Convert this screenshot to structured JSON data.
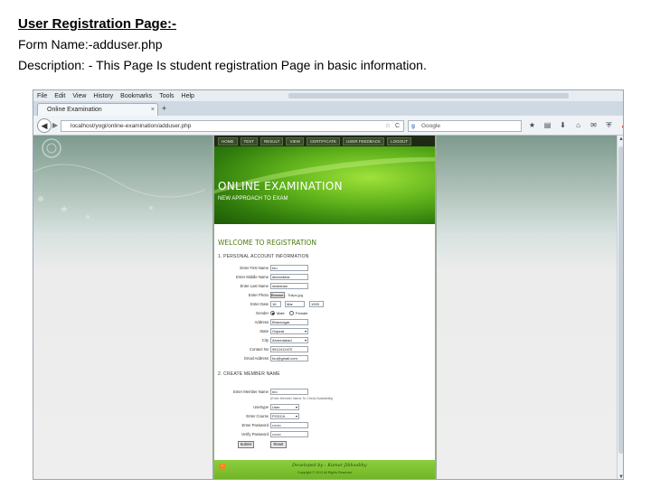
{
  "document": {
    "heading": "User Registration Page:-",
    "form_name": "Form Name:-adduser.php",
    "description": "Description: - This Page Is student registration Page in basic information."
  },
  "browser": {
    "menu": [
      "File",
      "Edit",
      "View",
      "History",
      "Bookmarks",
      "Tools",
      "Help"
    ],
    "tab_title": "Online Examination",
    "tab_close": "×",
    "new_tab": "+",
    "url": "localhost/yogi/online-examination/adduser.php",
    "search_placeholder": "Google",
    "search_logo": "g",
    "nav_back": "◀",
    "nav_forward": "▶",
    "reload": "C",
    "star": "☆",
    "toolbar_icons": [
      "star-icon",
      "bookmarks-icon",
      "download-icon",
      "home-icon",
      "share-icon",
      "shield-icon",
      "addon-icon",
      "help-icon",
      "menu-icon"
    ],
    "toolbar_glyphs": [
      "★",
      "▤",
      "⬇",
      "⌂",
      "✉",
      "⛨",
      "✗",
      "?",
      "≡"
    ]
  },
  "site": {
    "nav": [
      "HOME",
      "TEST",
      "RESULT",
      "VIEW",
      "CERTIFICATE",
      "USER FEEDBACK",
      "LOGOUT"
    ],
    "banner_title": "ONLINE EXAMINATION",
    "banner_subtitle": "NEW APPROACH TO EXAM",
    "welcome": "WELCOME TO REGISTRATION",
    "section1_title": "1. PERSONAL ACCOUNT INFORMATION",
    "section2_title": "2. CREATE MEMBER NAME",
    "personal_fields": [
      {
        "label": "Enter First Name",
        "value": "kru"
      },
      {
        "label": "Enter Middle Name",
        "value": "dineshbhai"
      },
      {
        "label": "Enter Last Name",
        "value": "shakshan"
      }
    ],
    "photo_label": "Enter Photo",
    "photo_button": "Browse...",
    "photo_file": "Tulips.jpg",
    "dob_label": "Enter Date",
    "dob_day": "16",
    "dob_month": "Mar",
    "dob_year": "1993",
    "gender_label": "Gender",
    "gender_male": "Male",
    "gender_female": "Female",
    "after_fields": [
      {
        "label": "Address",
        "value": "Bhavnagar",
        "type": "input"
      },
      {
        "label": "State",
        "value": "Gujarat",
        "type": "select"
      },
      {
        "label": "City",
        "value": "Ahmedabad",
        "type": "select"
      },
      {
        "label": "Contact No",
        "value": "9512412470",
        "type": "input"
      },
      {
        "label": "Email Address",
        "value": "kru@gmail.com",
        "type": "input"
      }
    ],
    "member_fields": [
      {
        "label": "Enter Member Name",
        "value": "kru",
        "type": "input"
      },
      {
        "label": "",
        "value": "(Enter Member Name To Check Availability)",
        "type": "hint"
      },
      {
        "label": "Usertype",
        "value": "User",
        "type": "select"
      },
      {
        "label": "Enter Course",
        "value": "PGDCA",
        "type": "select"
      },
      {
        "label": "Enter Password",
        "value": "•••••••",
        "type": "input"
      },
      {
        "label": "Verify Password",
        "value": "•••••••",
        "type": "input"
      }
    ],
    "submit_label": "Submit",
    "reset_label": "Reset",
    "footer_title": "Developed by : Kumar Jibhsabhy",
    "footer_copy": "Copyright © 2013 All Rights Reserved",
    "rss_glyph": "◔"
  }
}
